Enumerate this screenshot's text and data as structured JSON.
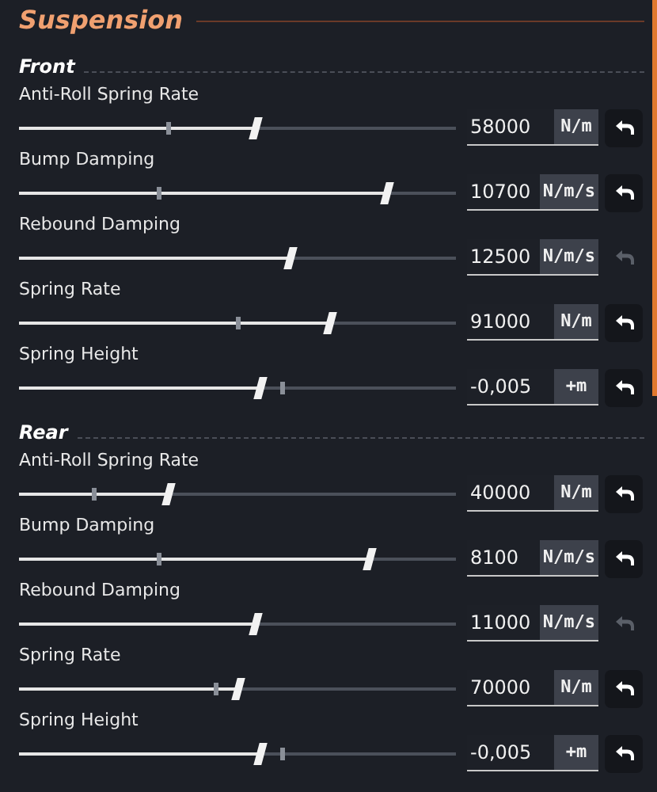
{
  "title": "Suspension",
  "sections": [
    {
      "label": "Front",
      "rows": [
        {
          "label": "Anti-Roll Spring Rate",
          "level": 0.54,
          "default_marker": {
            "level": 0.34
          },
          "value": "58000",
          "unit": "N/m",
          "resettable": true
        },
        {
          "label": "Bump Damping",
          "level": 0.84,
          "default_marker": {
            "level": 0.32
          },
          "value": "10700",
          "unit": "N/m/s",
          "resettable": true
        },
        {
          "label": "Rebound Damping",
          "level": 0.62,
          "value": "12500",
          "unit": "N/m/s",
          "resettable": false
        },
        {
          "label": "Spring Rate",
          "level": 0.71,
          "default_marker": {
            "level": 0.5
          },
          "value": "91000",
          "unit": "N/m",
          "resettable": true
        },
        {
          "label": "Spring Height",
          "level": 0.55,
          "default_marker": {
            "level": 0.6
          },
          "value": "-0,005",
          "unit": "+m",
          "resettable": true
        }
      ]
    },
    {
      "label": "Rear",
      "rows": [
        {
          "label": "Anti-Roll Spring Rate",
          "level": 0.34,
          "default_marker": {
            "level": 0.17
          },
          "value": "40000",
          "unit": "N/m",
          "resettable": true
        },
        {
          "label": "Bump Damping",
          "level": 0.8,
          "default_marker": {
            "level": 0.32
          },
          "value": "8100",
          "unit": "N/m/s",
          "resettable": true
        },
        {
          "label": "Rebound Damping",
          "level": 0.54,
          "value": "11000",
          "unit": "N/m/s",
          "resettable": false
        },
        {
          "label": "Spring Rate",
          "level": 0.5,
          "default_marker": {
            "level": 0.45
          },
          "value": "70000",
          "unit": "N/m",
          "resettable": true
        },
        {
          "label": "Spring Height",
          "level": 0.55,
          "default_marker": {
            "level": 0.6
          },
          "value": "-0,005",
          "unit": "+m",
          "resettable": true
        }
      ]
    }
  ]
}
